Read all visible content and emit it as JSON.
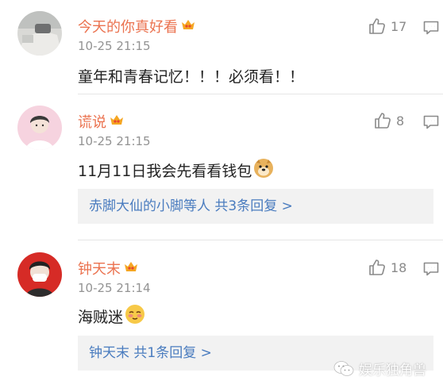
{
  "comments": [
    {
      "name": "今天的你真好看",
      "time": "10-25 21:15",
      "text": "童年和青春记忆！！！必须看！！",
      "likes": "17"
    },
    {
      "name": "谎说",
      "time": "10-25 21:15",
      "text": "11月11日我会先看看钱包",
      "likes": "8",
      "replies": {
        "users": "赤脚大仙的小脚",
        "suffix": "等人 共3条回复 >"
      }
    },
    {
      "name": "钟天末",
      "time": "10-25 21:14",
      "text": "海贼迷",
      "likes": "18",
      "replies": {
        "users": "钟天末",
        "suffix": " 共1条回复 >"
      }
    }
  ],
  "watermark": "娱乐独角兽",
  "colors": {
    "name": "#eb7350",
    "link": "#4a7cbf",
    "meta": "#939393",
    "text": "#222222",
    "reply_bg": "#f2f2f2"
  },
  "icons": {
    "like": "thumbs-up-icon",
    "reply": "comment-bubble-icon",
    "vip": "vip-crown-icon",
    "emoji_doge": "doge-emoji-icon",
    "emoji_shy": "shy-face-emoji-icon",
    "watermark": "wechat-logo-icon"
  }
}
